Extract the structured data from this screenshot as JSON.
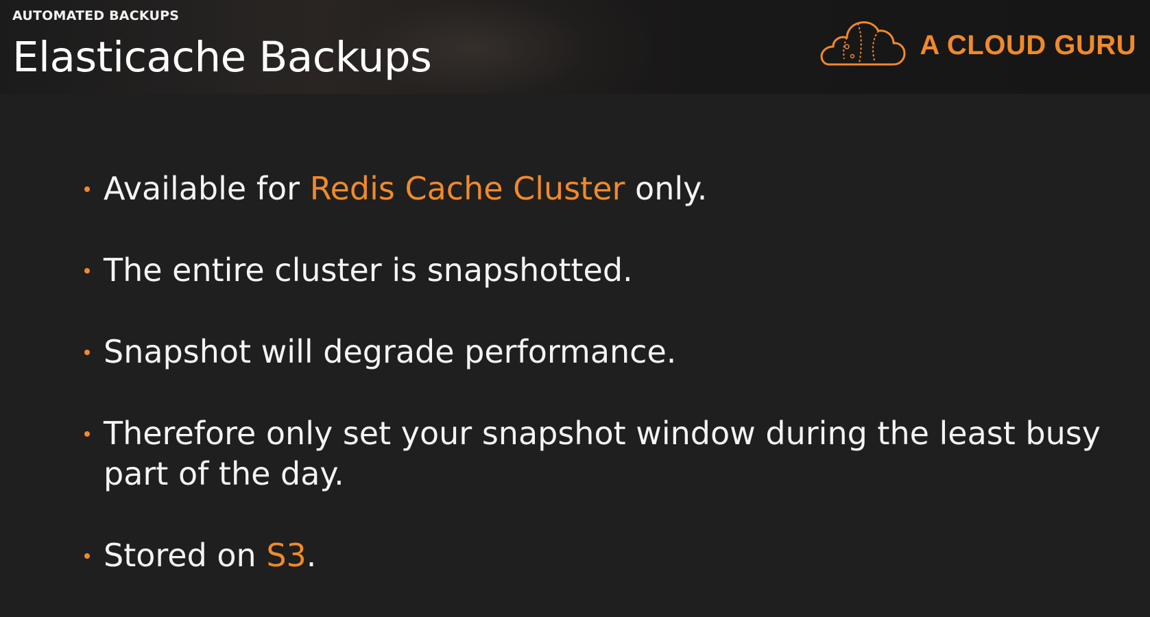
{
  "header": {
    "eyebrow": "AUTOMATED BACKUPS",
    "title": "Elasticache Backups",
    "brand_name": "A CLOUD GURU",
    "brand_icon": "cloud-logo-icon"
  },
  "colors": {
    "background": "#1f1f1f",
    "header_background": "#181818",
    "text": "#f4f4f4",
    "accent": "#f08a2a"
  },
  "bullets": [
    {
      "before": "Available for ",
      "highlight": "Redis Cache Cluster",
      "after": " only."
    },
    {
      "before": "The entire cluster is snapshotted.",
      "highlight": "",
      "after": ""
    },
    {
      "before": "Snapshot will degrade performance.",
      "highlight": "",
      "after": ""
    },
    {
      "before": "Therefore only set your snapshot window during the least busy part of the day.",
      "highlight": "",
      "after": ""
    },
    {
      "before": "Stored on ",
      "highlight": "S3",
      "after": "."
    }
  ]
}
